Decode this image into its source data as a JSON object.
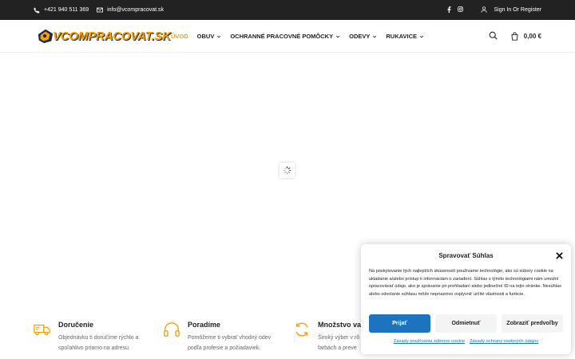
{
  "topbar": {
    "phone": "+421 940 511 369",
    "email": "info@vcompracovat.sk",
    "signin": "Sign In Or Register"
  },
  "header": {
    "logo_part1": "VCOM",
    "logo_part2": "PRACOVAT.SK",
    "nav": [
      {
        "label": "ÚVOD",
        "active": true
      },
      {
        "label": "OBUV"
      },
      {
        "label": "OCHRANNÉ PRACOVNÉ POMÔCKY"
      },
      {
        "label": "ODEVY"
      },
      {
        "label": "RUKAVICE"
      }
    ],
    "cart_total": "0,00 €",
    "accent_color": "#f0a30a"
  },
  "features": [
    {
      "title": "Doručenie",
      "desc": "Objednávku ti doručíme rýchlo a spoľahlivo priamo na adresu.",
      "icon": "truck-icon"
    },
    {
      "title": "Poradíme",
      "desc": "Pomôžeme ti vybrať vhodný odev podľa profesie a požiadaviek.",
      "icon": "headphones-icon"
    },
    {
      "title": "Množstvo var",
      "desc": "Široký výber v rô farbách a preve",
      "icon": "refresh-icon"
    }
  ],
  "consent": {
    "title": "Spravovať Súhlas",
    "text": "Na poskytovanie tých najlepších skúseností používame technológie, ako sú súbory cookie na ukladanie a/alebo prístup k informáciám o zariadení. Súhlas s týmito technológiami nám umožní spracovávať údaje, ako je správanie pri prehliadaní alebo jedinečné ID na tejto stránke. Nesúhlas alebo odvolanie súhlasu môže nepriaznivo ovplyvniť určité vlastnosti a funkcie.",
    "accept": "Prijať",
    "deny": "Odmietnuť",
    "prefs": "Zobraziť predvoľby",
    "link1": "Zásady používania súborov cookie",
    "link2": "Zásady ochrany osobných údajov",
    "button_color": "#1e73be"
  }
}
